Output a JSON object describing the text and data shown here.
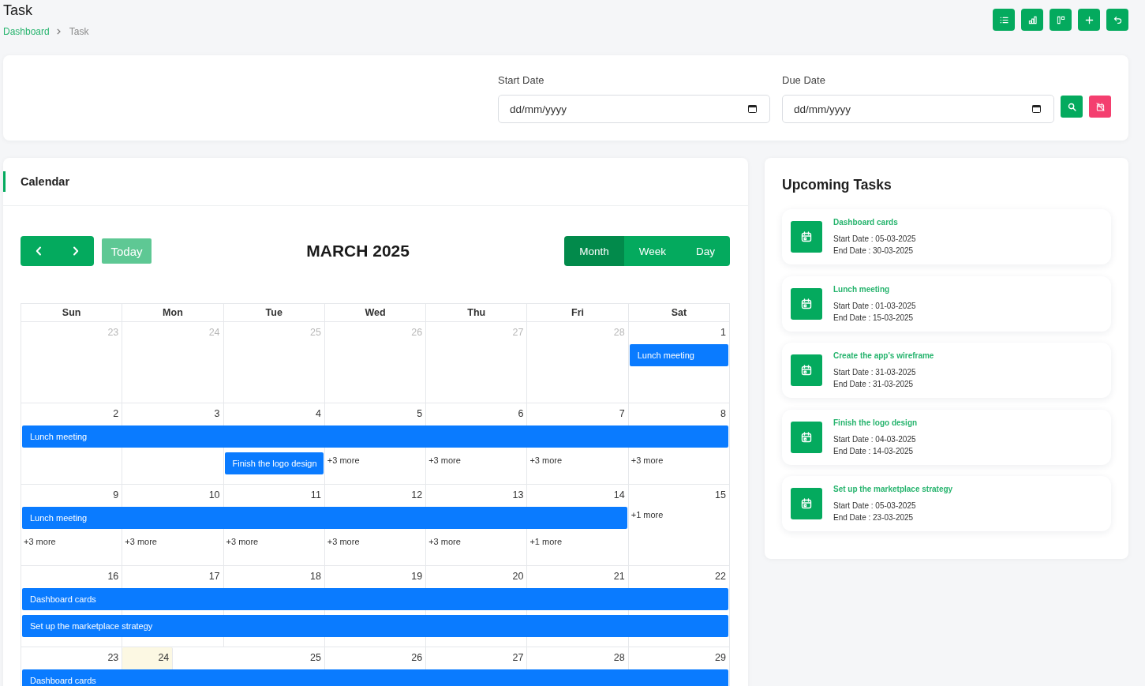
{
  "header": {
    "title": "Task",
    "breadcrumb": [
      {
        "label": "Dashboard",
        "current": false
      },
      {
        "label": "Task",
        "current": true
      }
    ]
  },
  "filters": {
    "fields": [
      {
        "label": "Start Date",
        "placeholder": "dd/mm/yyyy"
      },
      {
        "label": "Due Date",
        "placeholder": "dd/mm/yyyy"
      }
    ]
  },
  "calendar": {
    "heading": "Calendar",
    "title": "MARCH 2025",
    "today_button": {
      "label": "Today",
      "disabled": true
    },
    "views": [
      {
        "label": "Month",
        "selected": true
      },
      {
        "label": "Week",
        "selected": false
      },
      {
        "label": "Day",
        "selected": false
      }
    ],
    "weekdays": [
      "Sun",
      "Mon",
      "Tue",
      "Wed",
      "Thu",
      "Fri",
      "Sat"
    ],
    "weeks": [
      {
        "days": [
          {
            "day": "23",
            "other_month": true,
            "today": false
          },
          {
            "day": "24",
            "other_month": true,
            "today": false
          },
          {
            "day": "25",
            "other_month": true,
            "today": false
          },
          {
            "day": "26",
            "other_month": true,
            "today": false
          },
          {
            "day": "27",
            "other_month": true,
            "today": false
          },
          {
            "day": "28",
            "other_month": true,
            "today": false
          },
          {
            "day": "1",
            "other_month": false,
            "today": false
          }
        ],
        "lanes": [
          [
            {
              "kind": "empty"
            },
            {
              "kind": "empty"
            },
            {
              "kind": "empty"
            },
            {
              "kind": "empty"
            },
            {
              "kind": "empty"
            },
            {
              "kind": "empty"
            },
            {
              "kind": "event",
              "title": "Lunch meeting"
            }
          ]
        ]
      },
      {
        "days": [
          {
            "day": "2",
            "other_month": false,
            "today": false
          },
          {
            "day": "3",
            "other_month": false,
            "today": false
          },
          {
            "day": "4",
            "other_month": false,
            "today": false
          },
          {
            "day": "5",
            "other_month": false,
            "today": false
          },
          {
            "day": "6",
            "other_month": false,
            "today": false
          },
          {
            "day": "7",
            "other_month": false,
            "today": false
          },
          {
            "day": "8",
            "other_month": false,
            "today": false
          }
        ],
        "lanes": [
          [
            {
              "kind": "event",
              "title": "Lunch meeting"
            },
            {
              "kind": "cont"
            },
            {
              "kind": "cont"
            },
            {
              "kind": "cont"
            },
            {
              "kind": "cont"
            },
            {
              "kind": "cont"
            },
            {
              "kind": "cont"
            }
          ],
          [
            {
              "kind": "empty"
            },
            {
              "kind": "empty"
            },
            {
              "kind": "event",
              "title": "Finish the logo design"
            },
            {
              "kind": "more",
              "label": "+3 more"
            },
            {
              "kind": "more",
              "label": "+3 more"
            },
            {
              "kind": "more",
              "label": "+3 more"
            },
            {
              "kind": "more",
              "label": "+3 more"
            }
          ]
        ]
      },
      {
        "days": [
          {
            "day": "9",
            "other_month": false,
            "today": false
          },
          {
            "day": "10",
            "other_month": false,
            "today": false
          },
          {
            "day": "11",
            "other_month": false,
            "today": false
          },
          {
            "day": "12",
            "other_month": false,
            "today": false
          },
          {
            "day": "13",
            "other_month": false,
            "today": false
          },
          {
            "day": "14",
            "other_month": false,
            "today": false
          },
          {
            "day": "15",
            "other_month": false,
            "today": false
          }
        ],
        "lanes": [
          [
            {
              "kind": "event",
              "title": "Lunch meeting"
            },
            {
              "kind": "cont"
            },
            {
              "kind": "cont"
            },
            {
              "kind": "cont"
            },
            {
              "kind": "cont"
            },
            {
              "kind": "cont"
            },
            {
              "kind": "more",
              "label": "+1 more"
            }
          ],
          [
            {
              "kind": "more",
              "label": "+3 more"
            },
            {
              "kind": "more",
              "label": "+3 more"
            },
            {
              "kind": "more",
              "label": "+3 more"
            },
            {
              "kind": "more",
              "label": "+3 more"
            },
            {
              "kind": "more",
              "label": "+3 more"
            },
            {
              "kind": "more",
              "label": "+1 more"
            },
            {
              "kind": "empty"
            }
          ]
        ]
      },
      {
        "days": [
          {
            "day": "16",
            "other_month": false,
            "today": false
          },
          {
            "day": "17",
            "other_month": false,
            "today": false
          },
          {
            "day": "18",
            "other_month": false,
            "today": false
          },
          {
            "day": "19",
            "other_month": false,
            "today": false
          },
          {
            "day": "20",
            "other_month": false,
            "today": false
          },
          {
            "day": "21",
            "other_month": false,
            "today": false
          },
          {
            "day": "22",
            "other_month": false,
            "today": false
          }
        ],
        "lanes": [
          [
            {
              "kind": "event",
              "title": "Dashboard cards"
            },
            {
              "kind": "cont"
            },
            {
              "kind": "cont"
            },
            {
              "kind": "cont"
            },
            {
              "kind": "cont"
            },
            {
              "kind": "cont"
            },
            {
              "kind": "cont"
            }
          ],
          [
            {
              "kind": "event",
              "title": "Set up the marketplace strategy"
            },
            {
              "kind": "cont"
            },
            {
              "kind": "cont"
            },
            {
              "kind": "cont"
            },
            {
              "kind": "cont"
            },
            {
              "kind": "cont"
            },
            {
              "kind": "cont"
            }
          ]
        ]
      },
      {
        "days": [
          {
            "day": "23",
            "other_month": false,
            "today": false
          },
          {
            "day": "24",
            "other_month": false,
            "today": true
          },
          {
            "day": "25",
            "other_month": false,
            "today": false
          },
          {
            "day": "26",
            "other_month": false,
            "today": false
          },
          {
            "day": "27",
            "other_month": false,
            "today": false
          },
          {
            "day": "28",
            "other_month": false,
            "today": false
          },
          {
            "day": "29",
            "other_month": false,
            "today": false
          }
        ],
        "lanes": [
          [
            {
              "kind": "event",
              "title": "Dashboard cards"
            },
            {
              "kind": "cont"
            },
            {
              "kind": "cont"
            },
            {
              "kind": "cont"
            },
            {
              "kind": "cont"
            },
            {
              "kind": "cont"
            },
            {
              "kind": "cont"
            }
          ]
        ]
      }
    ]
  },
  "upcoming": {
    "title": "Upcoming Tasks",
    "tasks": [
      {
        "title": "Dashboard cards",
        "start": "Start Date : 05-03-2025",
        "end": "End Date : 30-03-2025"
      },
      {
        "title": "Lunch meeting",
        "start": "Start Date : 01-03-2025",
        "end": "End Date : 15-03-2025"
      },
      {
        "title": "Create the app's wireframe",
        "start": "Start Date : 31-03-2025",
        "end": "End Date : 31-03-2025"
      },
      {
        "title": "Finish the logo design",
        "start": "Start Date : 04-03-2025",
        "end": "End Date : 14-03-2025"
      },
      {
        "title": "Set up the marketplace strategy",
        "start": "Start Date : 05-03-2025",
        "end": "End Date : 23-03-2025"
      }
    ]
  }
}
